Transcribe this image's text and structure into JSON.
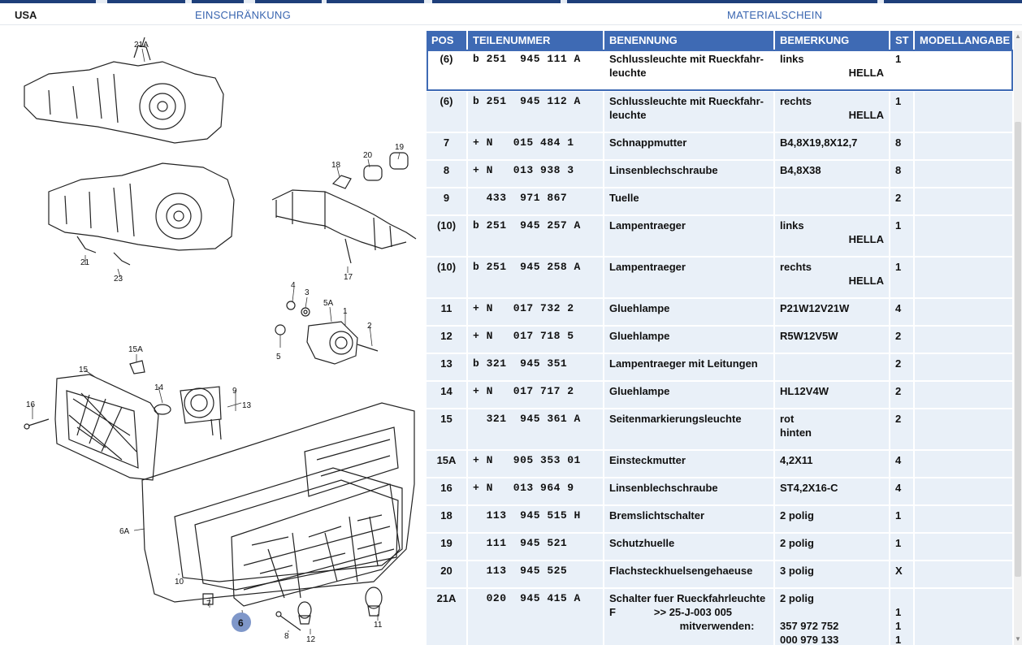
{
  "header": {
    "region": "USA",
    "restriction_label": "EINSCHRÄNKUNG",
    "material_label": "MATERIALSCHEIN"
  },
  "diagram": {
    "callouts": [
      "21A",
      "20",
      "19",
      "18",
      "21",
      "23",
      "17",
      "4",
      "3",
      "5A",
      "1",
      "2",
      "5",
      "15A",
      "15",
      "14",
      "9",
      "13",
      "16",
      "6A",
      "10",
      "7",
      "6",
      "8",
      "12",
      "11"
    ],
    "highlighted": "6"
  },
  "table": {
    "columns": [
      "POS",
      "TEILENUMMER",
      "BENENNUNG",
      "BEMERKUNG",
      "ST",
      "MODELLANGABE"
    ],
    "rows": [
      {
        "pos": "(6)",
        "tn": "b 251  945 111 A",
        "ben": [
          "Schlussleuchte mit Rueckfahr-",
          "leuchte"
        ],
        "bem": [
          "links"
        ],
        "maker": "HELLA",
        "st": [
          "1"
        ],
        "sel": true
      },
      {
        "pos": "(6)",
        "tn": "b 251  945 112 A",
        "ben": [
          "Schlussleuchte mit Rueckfahr-",
          "leuchte"
        ],
        "bem": [
          "rechts"
        ],
        "maker": "HELLA",
        "st": [
          "1"
        ]
      },
      {
        "pos": "7",
        "tn": "+ N   015 484 1",
        "ben": [
          "Schnappmutter"
        ],
        "bem": [
          "B4,8X19,8X12,7"
        ],
        "st": [
          "8"
        ]
      },
      {
        "pos": "8",
        "tn": "+ N   013 938 3",
        "ben": [
          "Linsenblechschraube"
        ],
        "bem": [
          "B4,8X38"
        ],
        "st": [
          "8"
        ]
      },
      {
        "pos": "9",
        "tn": "  433  971 867",
        "ben": [
          "Tuelle"
        ],
        "bem": [
          ""
        ],
        "st": [
          "2"
        ]
      },
      {
        "pos": "(10)",
        "tn": "b 251  945 257 A",
        "ben": [
          "Lampentraeger"
        ],
        "bem": [
          "links"
        ],
        "maker": "HELLA",
        "st": [
          "1"
        ]
      },
      {
        "pos": "(10)",
        "tn": "b 251  945 258 A",
        "ben": [
          "Lampentraeger"
        ],
        "bem": [
          "rechts"
        ],
        "maker": "HELLA",
        "st": [
          "1"
        ]
      },
      {
        "pos": "11",
        "tn": "+ N   017 732 2",
        "ben": [
          "Gluehlampe"
        ],
        "bem": [
          "P21W12V21W"
        ],
        "st": [
          "4"
        ]
      },
      {
        "pos": "12",
        "tn": "+ N   017 718 5",
        "ben": [
          "Gluehlampe"
        ],
        "bem": [
          "R5W12V5W"
        ],
        "st": [
          "2"
        ]
      },
      {
        "pos": "13",
        "tn": "b 321  945 351",
        "ben": [
          "Lampentraeger mit Leitungen"
        ],
        "bem": [
          ""
        ],
        "st": [
          "2"
        ]
      },
      {
        "pos": "14",
        "tn": "+ N   017 717 2",
        "ben": [
          "Gluehlampe"
        ],
        "bem": [
          "HL12V4W"
        ],
        "st": [
          "2"
        ]
      },
      {
        "pos": "15",
        "tn": "  321  945 361 A",
        "ben": [
          "Seitenmarkierungsleuchte"
        ],
        "bem": [
          "rot",
          "hinten"
        ],
        "st": [
          "2"
        ]
      },
      {
        "pos": "15A",
        "tn": "+ N   905 353 01",
        "ben": [
          "Einsteckmutter"
        ],
        "bem": [
          "4,2X11"
        ],
        "st": [
          "4"
        ]
      },
      {
        "pos": "16",
        "tn": "+ N   013 964 9",
        "ben": [
          "Linsenblechschraube"
        ],
        "bem": [
          "ST4,2X16-C"
        ],
        "st": [
          "4"
        ]
      },
      {
        "pos": "18",
        "tn": "  113  945 515 H",
        "ben": [
          "Bremslichtschalter"
        ],
        "bem": [
          "2 polig"
        ],
        "st": [
          "1"
        ]
      },
      {
        "pos": "19",
        "tn": "  111  945 521",
        "ben": [
          "Schutzhuelle"
        ],
        "bem": [
          "2 polig"
        ],
        "st": [
          "1"
        ]
      },
      {
        "pos": "20",
        "tn": "  113  945 525",
        "ben": [
          "Flachsteckhuelsengehaeuse"
        ],
        "bem": [
          "3 polig"
        ],
        "st": [
          "X"
        ]
      },
      {
        "pos": "21A",
        "tn": "  020  945 415 A",
        "ben": [
          "Schalter fuer Rueckfahrleuchte",
          "F             >> 25-J-003 005",
          "                        mitverwenden:"
        ],
        "bem": [
          "2 polig",
          "",
          "357 972 752",
          "000 979 133"
        ],
        "st": [
          "",
          "1",
          "1",
          "1"
        ]
      }
    ]
  }
}
